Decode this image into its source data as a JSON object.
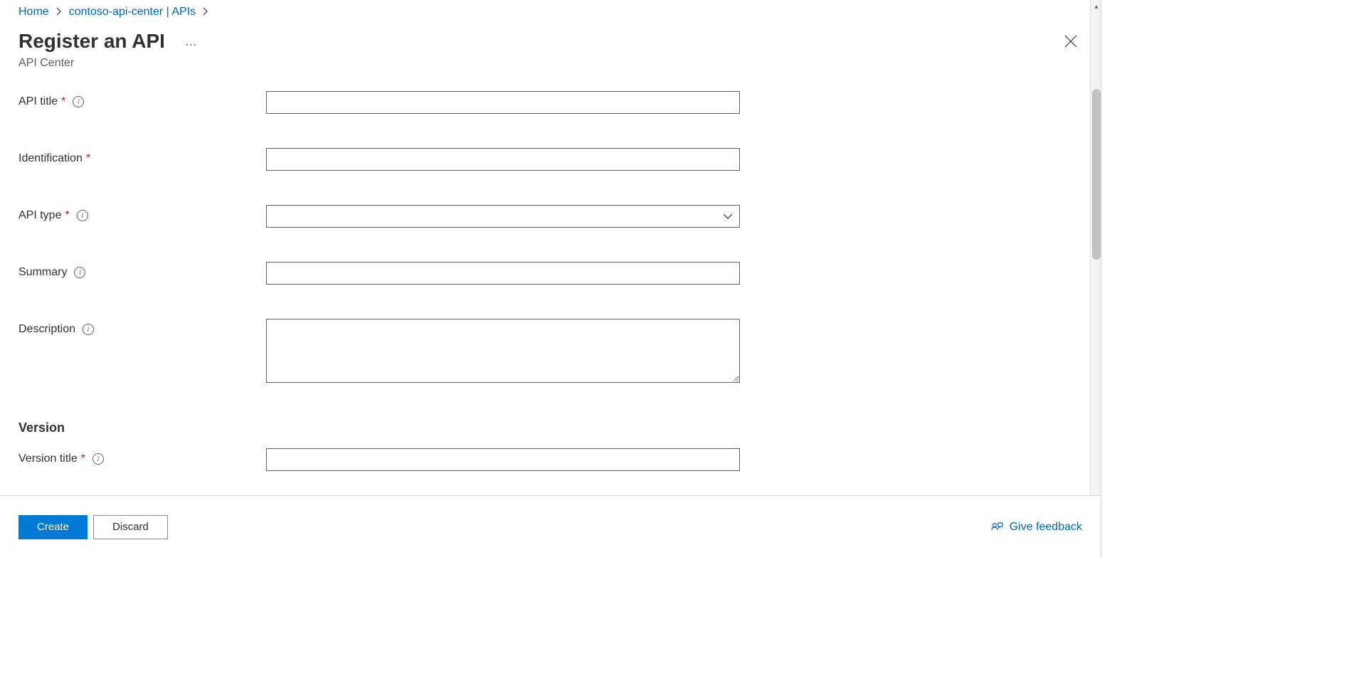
{
  "breadcrumb": {
    "home": "Home",
    "center": "contoso-api-center | APIs"
  },
  "header": {
    "title": "Register an API",
    "subtitle": "API Center"
  },
  "form": {
    "api_title": {
      "label": "API title",
      "value": ""
    },
    "identification": {
      "label": "Identification",
      "value": ""
    },
    "api_type": {
      "label": "API type",
      "value": ""
    },
    "summary": {
      "label": "Summary",
      "value": ""
    },
    "description": {
      "label": "Description",
      "value": ""
    },
    "version_section": "Version",
    "version_title": {
      "label": "Version title",
      "value": ""
    }
  },
  "footer": {
    "create": "Create",
    "discard": "Discard",
    "feedback": "Give feedback"
  }
}
